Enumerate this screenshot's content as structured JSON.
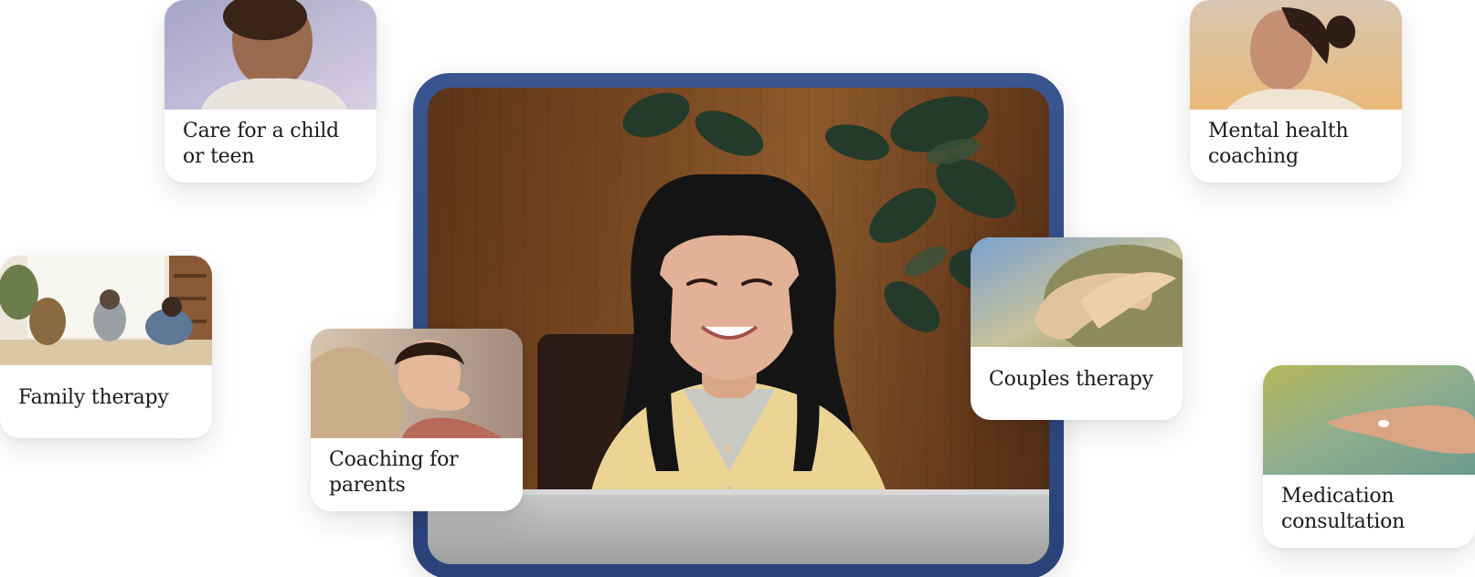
{
  "hero": {
    "image": "woman-smiling-at-laptop-video-call"
  },
  "services": [
    {
      "label": "Care for a child or teen",
      "image": "boy-looking-up"
    },
    {
      "label": "Mental health coaching",
      "image": "woman-profile"
    },
    {
      "label": "Family therapy",
      "image": "family-on-couch"
    },
    {
      "label": "Coaching for parents",
      "image": "parent-holding-child"
    },
    {
      "label": "Couples therapy",
      "image": "hands-on-shoulder"
    },
    {
      "label": "Medication consultation",
      "image": "hand-with-pill"
    }
  ],
  "colors": {
    "frame": "#2f4a84",
    "card_bg": "#ffffff",
    "text": "#1b1b1b"
  }
}
